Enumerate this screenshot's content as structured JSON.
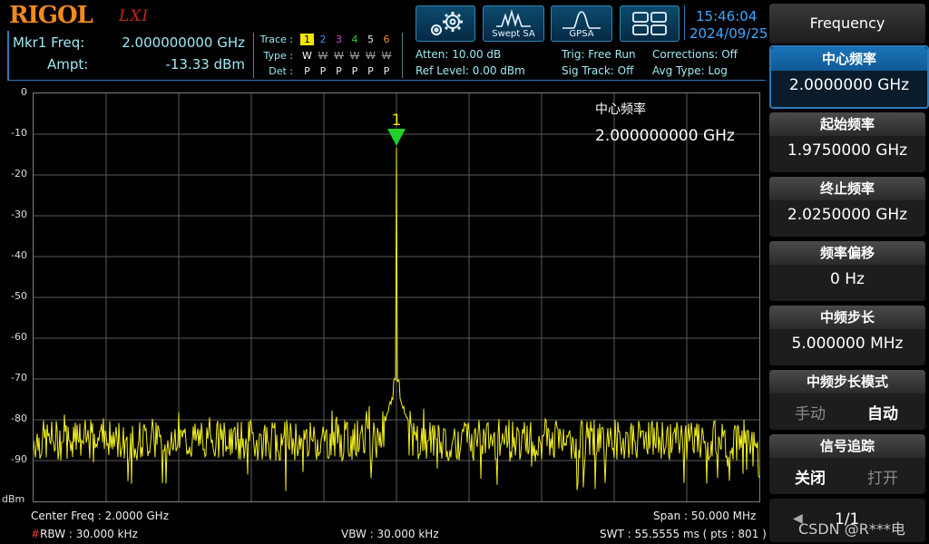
{
  "header": {
    "brand": "RIGOL",
    "lxi": "LXI",
    "marker": {
      "freq_label": "Mkr1 Freq:",
      "freq_value": "2.000000000 GHz",
      "ampt_label": "Ampt:",
      "ampt_value": "-13.33 dBm"
    },
    "trace": {
      "trace_label": "Trace :",
      "type_label": "Type :",
      "det_label": "Det :",
      "numbers": [
        "1",
        "2",
        "3",
        "4",
        "5",
        "6"
      ],
      "number_colors": [
        "#f5e500",
        "#3a8fe0",
        "#d445d4",
        "#2fd22f",
        "#e8e8e8",
        "#f08a30"
      ],
      "types": [
        "W",
        "W",
        "W",
        "W",
        "W",
        "W"
      ],
      "dets": [
        "P",
        "P",
        "P",
        "P",
        "P",
        "P"
      ]
    },
    "settings": {
      "atten": "Atten: 10.00 dB",
      "ref_level": "Ref Level: 0.00 dBm",
      "trig": "Trig: Free Run",
      "sig_track": "Sig Track: Off",
      "corrections": "Corrections: Off",
      "avg_type": "Avg Type: Log"
    },
    "modes": [
      "Swept SA",
      "GPSA"
    ],
    "clock": {
      "time": "15:46:04",
      "date": "2024/09/25"
    }
  },
  "plot": {
    "y_ticks": [
      "0",
      "-10",
      "-20",
      "-30",
      "-40",
      "-50",
      "-60",
      "-70",
      "-80",
      "-90"
    ],
    "y_unit": "dBm",
    "marker_number": "1",
    "annotation_title": "中心频率",
    "annotation_value": "2.000000000 GHz",
    "center_freq": "Center Freq : 2.0000 GHz",
    "span": "Span : 50.000 MHz",
    "rbw_hash": "#",
    "rbw": "RBW : 30.000 kHz",
    "vbw": "VBW : 30.000 kHz",
    "swt": "SWT : 55.5555 ms ( pts : 801 )",
    "trace_color": "#f2ef1f"
  },
  "chart_data": {
    "type": "line",
    "xlabel": "",
    "ylabel": "dBm",
    "ylim": [
      -100,
      0
    ],
    "x_range_ghz": [
      1.975,
      2.025
    ],
    "marker": {
      "x": 2.0,
      "y": -13.33
    },
    "noise_floor_db": -85,
    "grid": true
  },
  "panel": {
    "title": "Frequency",
    "keys": [
      {
        "title": "中心频率",
        "value": "2.0000000 GHz"
      },
      {
        "title": "起始频率",
        "value": "1.9750000 GHz"
      },
      {
        "title": "终止频率",
        "value": "2.0250000 GHz"
      },
      {
        "title": "频率偏移",
        "value": "0 Hz"
      },
      {
        "title": "中频步长",
        "value": "5.000000 MHz"
      }
    ],
    "step_mode": {
      "title": "中频步长模式",
      "left": "手动",
      "right": "自动"
    },
    "sig_track": {
      "title": "信号追踪",
      "left": "关闭",
      "right": "打开"
    },
    "page": "1/1",
    "watermark": "CSDN @R***电"
  }
}
